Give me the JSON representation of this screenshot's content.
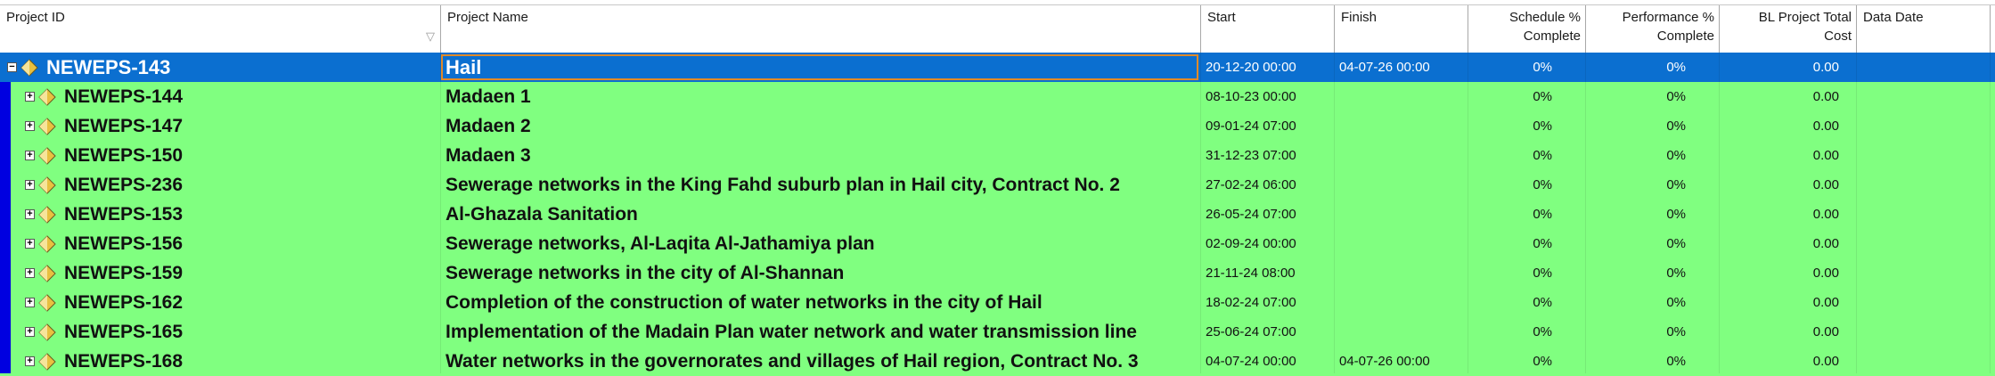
{
  "columns": [
    {
      "line1": "Project ID",
      "line2": ""
    },
    {
      "line1": "Project Name",
      "line2": ""
    },
    {
      "line1": "Start",
      "line2": ""
    },
    {
      "line1": "Finish",
      "line2": ""
    },
    {
      "line1": "Schedule %",
      "line2": "Complete"
    },
    {
      "line1": "Performance %",
      "line2": "Complete"
    },
    {
      "line1": "BL Project Total",
      "line2": "Cost"
    },
    {
      "line1": "Data Date",
      "line2": ""
    }
  ],
  "colors": {
    "selected_row": "#0b6fd0",
    "eps_row": "#80ff80",
    "edit_border": "#e08a2a",
    "tree_bar": "#0000e0"
  },
  "rows": [
    {
      "id": "NEWEPS-143",
      "name": "Hail",
      "start": "20-12-20 00:00",
      "finish": "04-07-26 00:00",
      "schedule": "0%",
      "performance": "0%",
      "cost": "0.00",
      "data_date": "",
      "selected": true,
      "toggle": "−"
    },
    {
      "id": "NEWEPS-144",
      "name": "Madaen 1",
      "start": "08-10-23 00:00",
      "finish": "",
      "schedule": "0%",
      "performance": "0%",
      "cost": "0.00",
      "data_date": "",
      "toggle": "+"
    },
    {
      "id": "NEWEPS-147",
      "name": "Madaen 2",
      "start": "09-01-24 07:00",
      "finish": "",
      "schedule": "0%",
      "performance": "0%",
      "cost": "0.00",
      "data_date": "",
      "toggle": "+"
    },
    {
      "id": "NEWEPS-150",
      "name": "Madaen 3",
      "start": "31-12-23 07:00",
      "finish": "",
      "schedule": "0%",
      "performance": "0%",
      "cost": "0.00",
      "data_date": "",
      "toggle": "+"
    },
    {
      "id": "NEWEPS-236",
      "name": "Sewerage networks in the King Fahd suburb plan in Hail city, Contract No. 2",
      "start": "27-02-24 06:00",
      "finish": "",
      "schedule": "0%",
      "performance": "0%",
      "cost": "0.00",
      "data_date": "",
      "toggle": "+"
    },
    {
      "id": "NEWEPS-153",
      "name": "Al-Ghazala Sanitation",
      "start": "26-05-24 07:00",
      "finish": "",
      "schedule": "0%",
      "performance": "0%",
      "cost": "0.00",
      "data_date": "",
      "toggle": "+"
    },
    {
      "id": "NEWEPS-156",
      "name": "Sewerage networks, Al-Laqita Al-Jathamiya plan",
      "start": "02-09-24 00:00",
      "finish": "",
      "schedule": "0%",
      "performance": "0%",
      "cost": "0.00",
      "data_date": "",
      "toggle": "+"
    },
    {
      "id": "NEWEPS-159",
      "name": "Sewerage networks in the city of Al-Shannan",
      "start": "21-11-24 08:00",
      "finish": "",
      "schedule": "0%",
      "performance": "0%",
      "cost": "0.00",
      "data_date": "",
      "toggle": "+"
    },
    {
      "id": "NEWEPS-162",
      "name": "Completion of the construction of water networks in the city of Hail",
      "start": "18-02-24 07:00",
      "finish": "",
      "schedule": "0%",
      "performance": "0%",
      "cost": "0.00",
      "data_date": "",
      "toggle": "+"
    },
    {
      "id": "NEWEPS-165",
      "name": "Implementation of the Madain Plan water network and water transmission line",
      "start": "25-06-24 07:00",
      "finish": "",
      "schedule": "0%",
      "performance": "0%",
      "cost": "0.00",
      "data_date": "",
      "toggle": "+"
    },
    {
      "id": "NEWEPS-168",
      "name": "Water networks in the governorates and villages of Hail region, Contract No. 3",
      "start": "04-07-24 00:00",
      "finish": "04-07-26 00:00",
      "schedule": "0%",
      "performance": "0%",
      "cost": "0.00",
      "data_date": "",
      "toggle": "+"
    }
  ]
}
